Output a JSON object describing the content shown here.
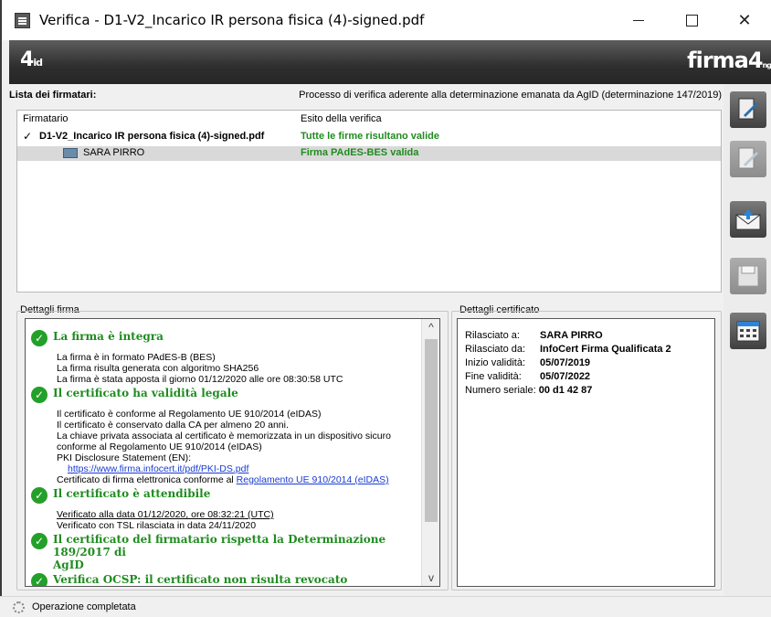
{
  "window": {
    "title": "Verifica - D1-V2_Incarico IR persona fisica (4)-signed.pdf",
    "minimize": "",
    "maximize": "",
    "close": "✕"
  },
  "banner": {
    "left_logo_main": "4",
    "left_logo_small": "id",
    "right_logo_main": "firma4",
    "right_logo_small": "ng"
  },
  "signers": {
    "heading": "Lista dei firmatari:",
    "process_note": "Processo di verifica aderente alla determinazione emanata da AgID (determinazione 147/2019)",
    "columns": [
      "Firmatario",
      "Esito della verifica"
    ],
    "rows": [
      {
        "name": "D1-V2_Incarico IR persona fisica (4)-signed.pdf",
        "result": "Tutte le firme risultano valide"
      },
      {
        "name": "SARA PIRRO",
        "result": "Firma PAdES-BES valida"
      }
    ]
  },
  "details": {
    "label": "Dettagli firma",
    "check1": {
      "title": "La firma è integra",
      "lines": [
        "La firma è in formato PAdES-B (BES)",
        "La firma risulta generata con algoritmo SHA256",
        "La firma è stata apposta il giorno 01/12/2020 alle ore 08:30:58 UTC"
      ]
    },
    "check2": {
      "title": "Il certificato ha validità legale",
      "lines": [
        "Il certificato è conforme al Regolamento UE 910/2014 (eIDAS)",
        "Il certificato è conservato dalla CA per almeno 20 anni.",
        "La chiave privata associata al certificato è memorizzata in un dispositivo sicuro",
        "conforme al Regolamento UE 910/2014 (eIDAS)",
        "PKI Disclosure Statement (EN):"
      ],
      "pki_link": "https://www.firma.infocert.it/pdf/PKI-DS.pdf",
      "cert_line_prefix": "Certificato di firma elettronica conforme al ",
      "cert_line_link": "Regolamento UE 910/2014 (eIDAS)"
    },
    "check3": {
      "title": "Il certificato è attendibile",
      "line1": "Verificato alla data 01/12/2020, ore 08:32:21 (UTC)",
      "line2": "Verificato con TSL rilasciata in data 24/11/2020"
    },
    "check4": {
      "title_line1": "Il certificato del firmatario rispetta la Determinazione 189/2017 di",
      "title_line2": "AgID"
    },
    "check5": {
      "title": "Verifica OCSP: il certificato non risulta revocato"
    },
    "scroll_up": "^",
    "scroll_down": "v"
  },
  "certificate": {
    "label": "Dettagli certificato",
    "rows": [
      {
        "key": "Rilasciato a:",
        "value": "SARA PIRRO"
      },
      {
        "key": "Rilasciato da:",
        "value": "InfoCert Firma Qualificata 2"
      },
      {
        "key": "Inizio validità:",
        "value": "05/07/2019"
      },
      {
        "key": "Fine validità:",
        "value": "05/07/2022"
      },
      {
        "key": "Numero seriale:",
        "value": "00 d1 42 87"
      }
    ]
  },
  "status": {
    "text": "Operazione completata"
  },
  "tools": [
    "document-sign-icon",
    "document-edit-icon",
    "envelope-icon",
    "save-icon",
    "calendar-icon"
  ]
}
